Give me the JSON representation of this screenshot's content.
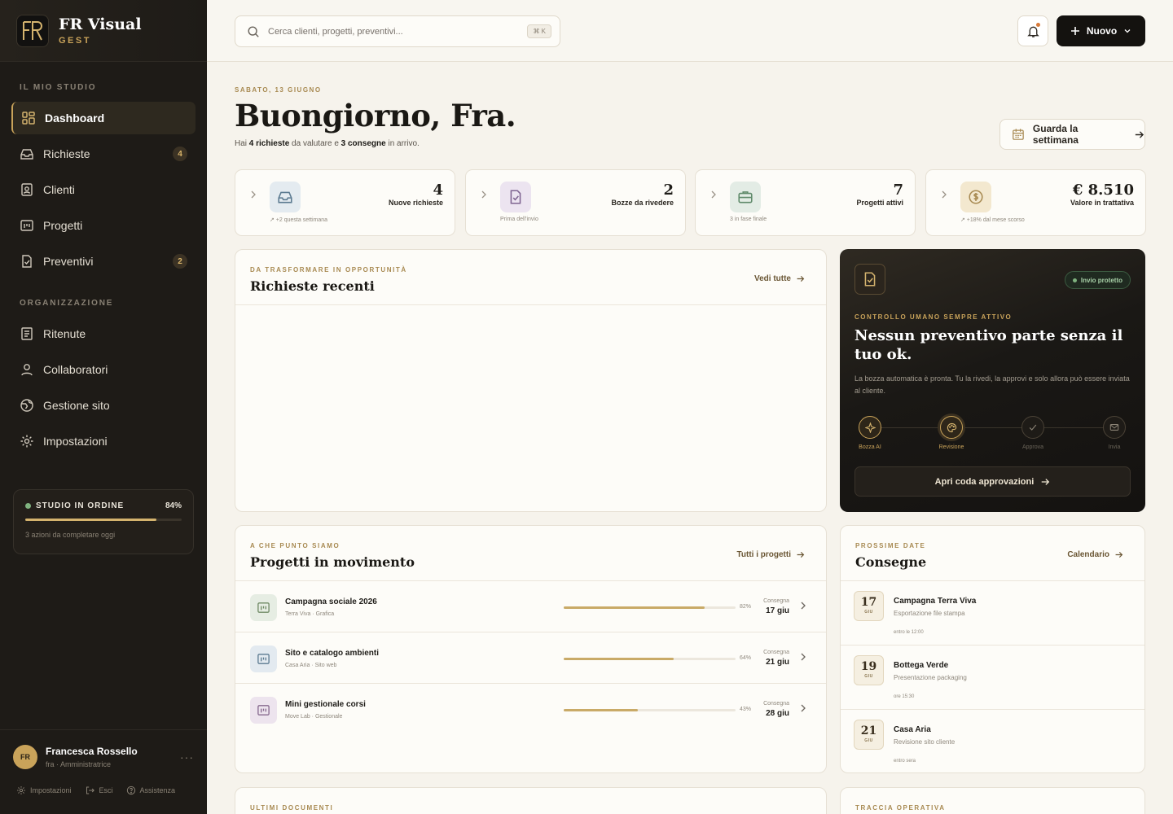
{
  "brand": {
    "name": "FR Visual",
    "sub": "GEST",
    "logo_text": "FR"
  },
  "sidebar": {
    "section_studio": "IL MIO STUDIO",
    "section_org": "ORGANIZZAZIONE",
    "items": [
      {
        "label": "Dashboard",
        "icon": "dashboard-icon"
      },
      {
        "label": "Richieste",
        "icon": "inbox-icon",
        "badge": "4"
      },
      {
        "label": "Clienti",
        "icon": "contact-icon"
      },
      {
        "label": "Progetti",
        "icon": "board-icon"
      },
      {
        "label": "Preventivi",
        "icon": "file-check-icon",
        "badge": "2"
      },
      {
        "label": "Ritenute",
        "icon": "receipt-icon"
      },
      {
        "label": "Collaboratori",
        "icon": "user-icon"
      },
      {
        "label": "Gestione sito",
        "icon": "globe-icon"
      },
      {
        "label": "Impostazioni",
        "icon": "gear-icon"
      }
    ],
    "status": {
      "label": "STUDIO IN ORDINE",
      "pct_text": "84%",
      "pct": 84,
      "note": "3 azioni da completare oggi"
    },
    "user": {
      "initials": "FR",
      "name": "Francesca Rossello",
      "role": "fra · Amministratrice",
      "more": "···"
    },
    "links": {
      "settings": "Impostazioni",
      "logout": "Esci",
      "help": "Assistenza"
    }
  },
  "topbar": {
    "search_placeholder": "Cerca clienti, progetti, preventivi...",
    "shortcut": "⌘ K",
    "new_label": "Nuovo"
  },
  "header": {
    "date": "SABATO, 13 GIUGNO",
    "greeting": "Buongiorno, Fra.",
    "sub_pre": "Hai ",
    "sub_b1": "4 richieste",
    "sub_mid": " da valutare e ",
    "sub_b2": "3 consegne",
    "sub_post": " in arrivo.",
    "week_button": "Guarda la settimana"
  },
  "kpis": [
    {
      "value": "4",
      "label": "Nuove richieste",
      "note": "↗ +2 questa settimana",
      "icon": "inbox-icon"
    },
    {
      "value": "2",
      "label": "Bozze da rivedere",
      "note": "Prima dell'invio",
      "icon": "file-check-icon"
    },
    {
      "value": "7",
      "label": "Progetti attivi",
      "note": "3 in fase finale",
      "icon": "briefcase-icon"
    },
    {
      "value": "€ 8.510",
      "label": "Valore in trattativa",
      "note": "↗ +18% dal mese scorso",
      "icon": "dollar-icon"
    }
  ],
  "requests": {
    "kicker": "DA TRASFORMARE IN OPPORTUNITÀ",
    "title": "Richieste recenti",
    "link": "Vedi tutte"
  },
  "approval": {
    "pill": "Invio protetto",
    "kicker": "CONTROLLO UMANO SEMPRE ATTIVO",
    "title": "Nessun preventivo parte senza il tuo ok.",
    "body": "La bozza automatica è pronta. Tu la rivedi, la approvi e solo allora può essere inviata al cliente.",
    "steps": [
      "Bozza AI",
      "Revisione",
      "Approva",
      "Invia"
    ],
    "button": "Apri coda approvazioni"
  },
  "projects": {
    "kicker": "A CHE PUNTO SIAMO",
    "title": "Progetti in movimento",
    "link": "Tutti i progetti",
    "deadline_label": "Consegna",
    "items": [
      {
        "name": "Campagna sociale 2026",
        "meta": "Terra Viva · Grafica",
        "progress": 82,
        "pct": "82%",
        "date": "17 giu"
      },
      {
        "name": "Sito e catalogo ambienti",
        "meta": "Casa Aria · Sito web",
        "progress": 64,
        "pct": "64%",
        "date": "21 giu"
      },
      {
        "name": "Mini gestionale corsi",
        "meta": "Move Lab · Gestionale",
        "progress": 43,
        "pct": "43%",
        "date": "28 giu"
      }
    ]
  },
  "deliveries": {
    "kicker": "PROSSIME DATE",
    "title": "Consegne",
    "link": "Calendario",
    "items": [
      {
        "day": "17",
        "month": "GIU",
        "name": "Campagna Terra Viva",
        "sub": "Esportazione file stampa",
        "time": "entro le 12:00"
      },
      {
        "day": "19",
        "month": "GIU",
        "name": "Bottega Verde",
        "sub": "Presentazione packaging",
        "time": "ore 15:30"
      },
      {
        "day": "21",
        "month": "GIU",
        "name": "Casa Aria",
        "sub": "Revisione sito cliente",
        "time": "entro sera"
      }
    ]
  },
  "documents": {
    "kicker": "ULTIMI DOCUMENTI"
  },
  "ops": {
    "kicker": "TRACCIA OPERATIVA"
  },
  "colors": {
    "accent": "#c9a35a",
    "sidebar": "#1e1b17",
    "background": "#f6f3ec",
    "dark_card": "#1a1815"
  }
}
